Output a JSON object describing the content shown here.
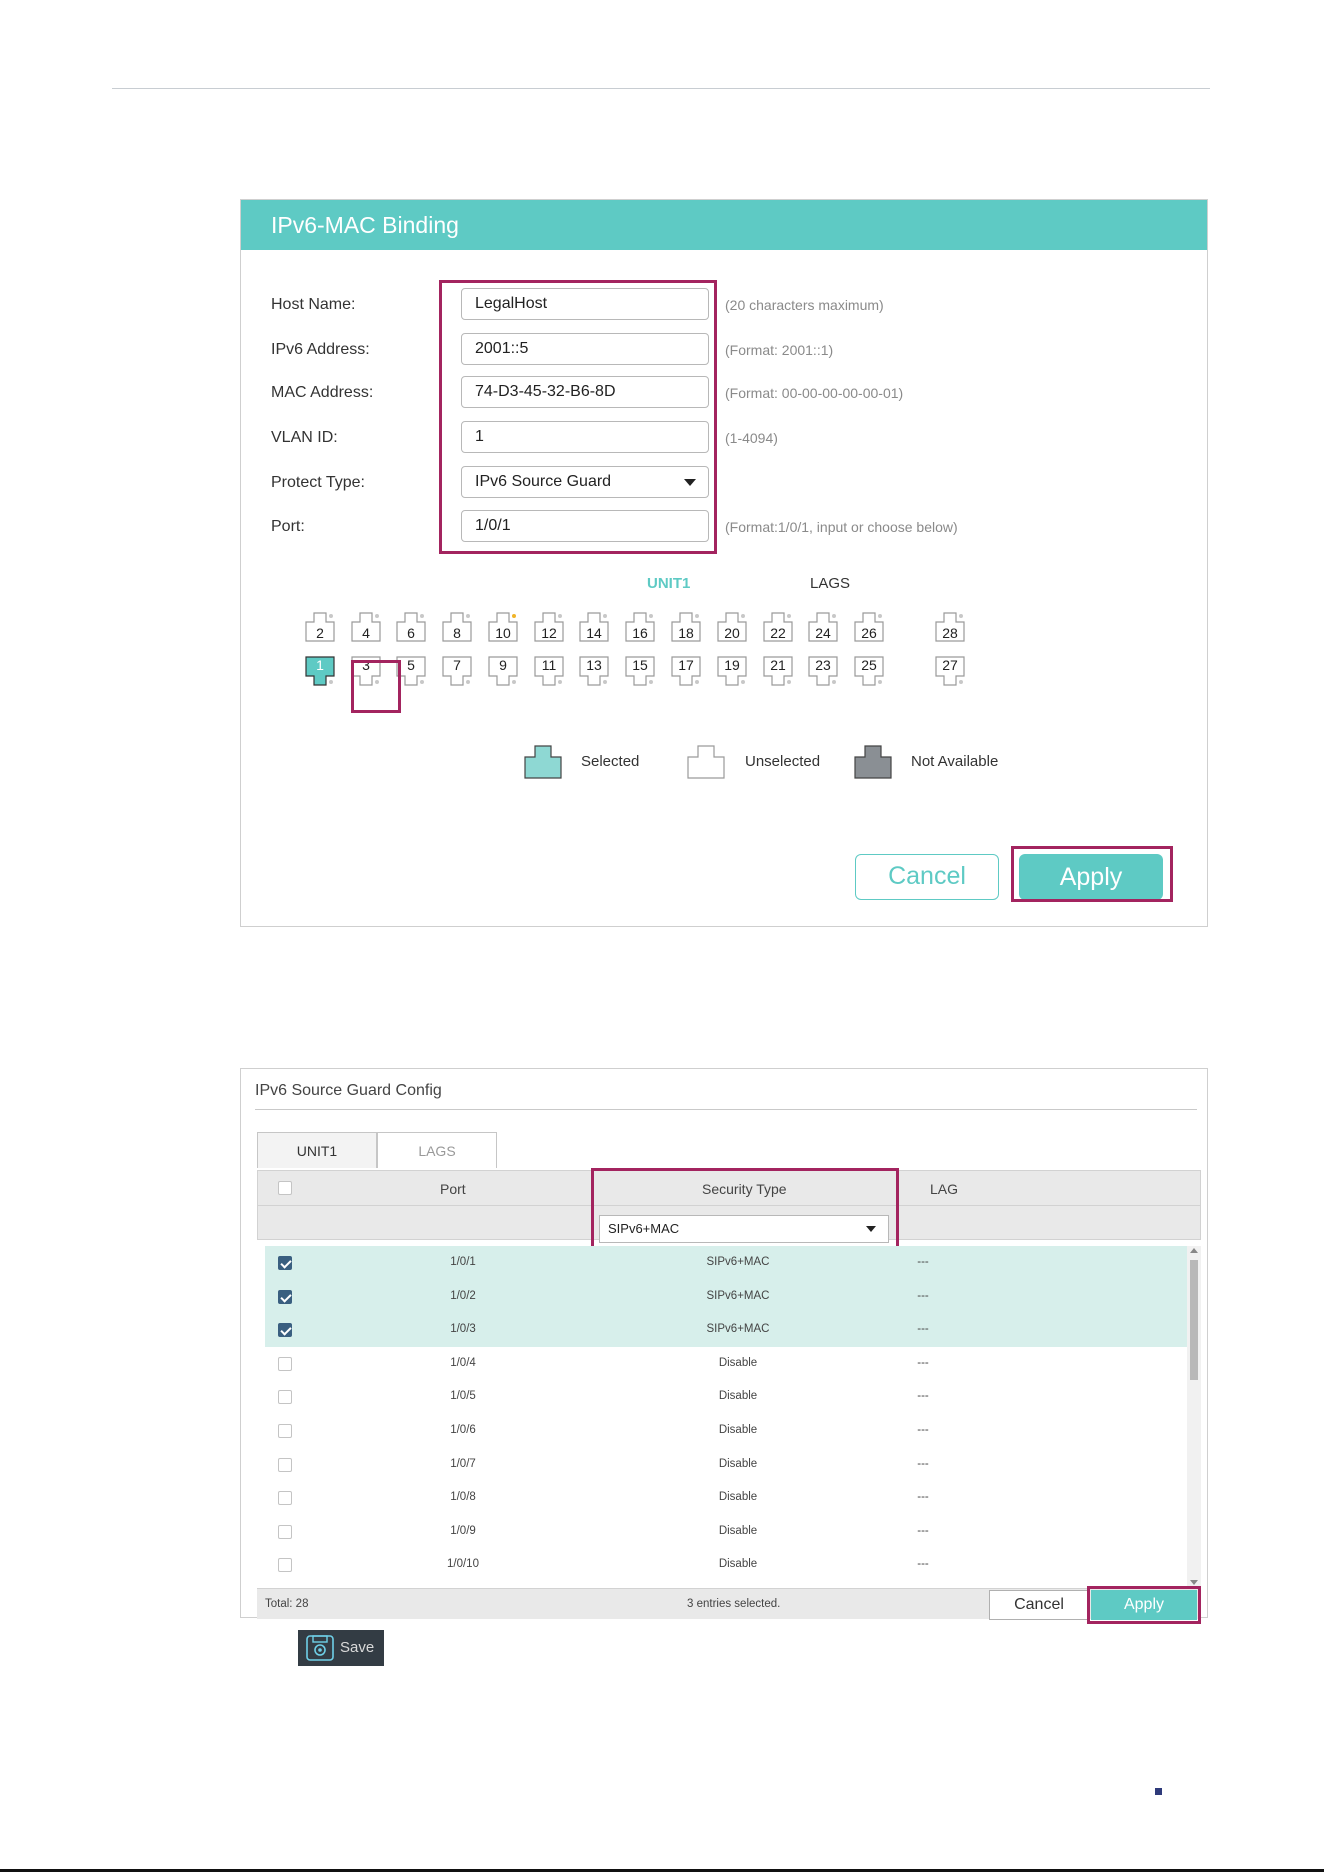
{
  "panel1": {
    "title": "IPv6-MAC Binding",
    "fields": [
      {
        "label": "Host Name:",
        "value": "LegalHost",
        "hint": "(20 characters maximum)"
      },
      {
        "label": "IPv6 Address:",
        "value": "2001::5",
        "hint": "(Format: 2001::1)"
      },
      {
        "label": "MAC Address:",
        "value": "74-D3-45-32-B6-8D",
        "hint": "(Format: 00-00-00-00-00-01)"
      },
      {
        "label": "VLAN ID:",
        "value": "1",
        "hint": "(1-4094)"
      },
      {
        "label": "Protect Type:",
        "value": "IPv6 Source Guard",
        "hint": ""
      },
      {
        "label": "Port:",
        "value": "1/0/1",
        "hint": "(Format:1/0/1, input or choose below)"
      }
    ],
    "unit_tab": "UNIT1",
    "lags_tab": "LAGS",
    "ports_top": [
      "2",
      "4",
      "6",
      "8",
      "10",
      "12",
      "14",
      "16",
      "18",
      "20",
      "22",
      "24",
      "26",
      "28"
    ],
    "ports_bottom": [
      "1",
      "3",
      "5",
      "7",
      "9",
      "11",
      "13",
      "15",
      "17",
      "19",
      "21",
      "23",
      "25",
      "27"
    ],
    "selected_port": "1",
    "legend": {
      "selected": "Selected",
      "unselected": "Unselected",
      "not_available": "Not Available"
    },
    "cancel_label": "Cancel",
    "apply_label": "Apply",
    "colors": {
      "accent": "#5ecac4",
      "highlight": "#a3245f",
      "unavailable": "#8a8f94"
    }
  },
  "panel2": {
    "title": "IPv6 Source Guard Config",
    "tabs": [
      "UNIT1",
      "LAGS"
    ],
    "columns": [
      "Port",
      "Security Type",
      "LAG"
    ],
    "filter_value": "SIPv6+MAC",
    "rows": [
      {
        "port": "1/0/1",
        "security": "SIPv6+MAC",
        "lag": "---",
        "checked": true
      },
      {
        "port": "1/0/2",
        "security": "SIPv6+MAC",
        "lag": "---",
        "checked": true
      },
      {
        "port": "1/0/3",
        "security": "SIPv6+MAC",
        "lag": "---",
        "checked": true
      },
      {
        "port": "1/0/4",
        "security": "Disable",
        "lag": "---",
        "checked": false
      },
      {
        "port": "1/0/5",
        "security": "Disable",
        "lag": "---",
        "checked": false
      },
      {
        "port": "1/0/6",
        "security": "Disable",
        "lag": "---",
        "checked": false
      },
      {
        "port": "1/0/7",
        "security": "Disable",
        "lag": "---",
        "checked": false
      },
      {
        "port": "1/0/8",
        "security": "Disable",
        "lag": "---",
        "checked": false
      },
      {
        "port": "1/0/9",
        "security": "Disable",
        "lag": "---",
        "checked": false
      },
      {
        "port": "1/0/10",
        "security": "Disable",
        "lag": "---",
        "checked": false
      }
    ],
    "total": "Total: 28",
    "selected_count": "3 entries selected.",
    "cancel_label": "Cancel",
    "apply_label": "Apply"
  },
  "save_label": "Save"
}
